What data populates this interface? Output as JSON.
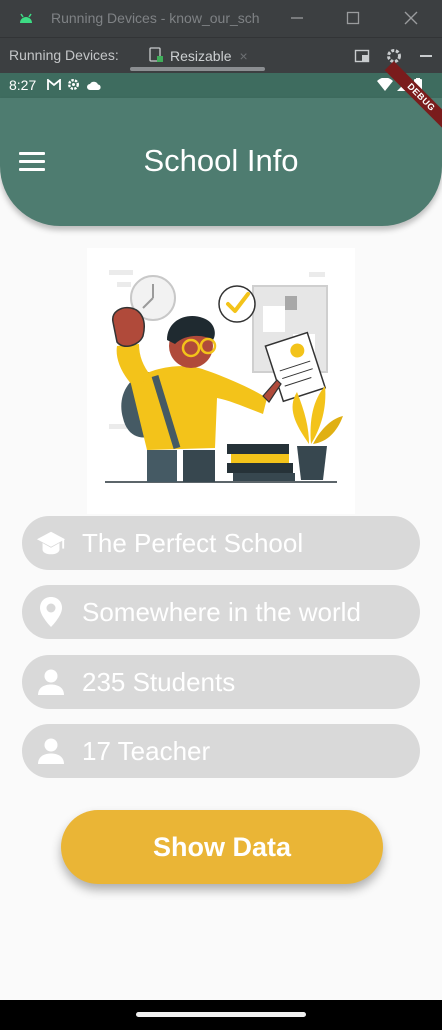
{
  "ide": {
    "window_title": "Running Devices - know_our_sch",
    "toolbar_label": "Running Devices:",
    "device_tab": "Resizable",
    "tab_close": "×"
  },
  "status_bar": {
    "time": "8:27",
    "debug_banner": "DEBUG"
  },
  "app": {
    "title": "School Info",
    "info": [
      {
        "icon": "school-icon",
        "text": "The Perfect School"
      },
      {
        "icon": "location-pin-icon",
        "text": "Somewhere in the world"
      },
      {
        "icon": "person-icon",
        "text": "235 Students"
      },
      {
        "icon": "person-icon",
        "text": "17 Teacher"
      }
    ],
    "button_label": "Show Data"
  },
  "colors": {
    "app_bar": "#4e7c70",
    "status_bar": "#3e6c5f",
    "pill": "#d9d9d9",
    "button": "#eab536"
  }
}
